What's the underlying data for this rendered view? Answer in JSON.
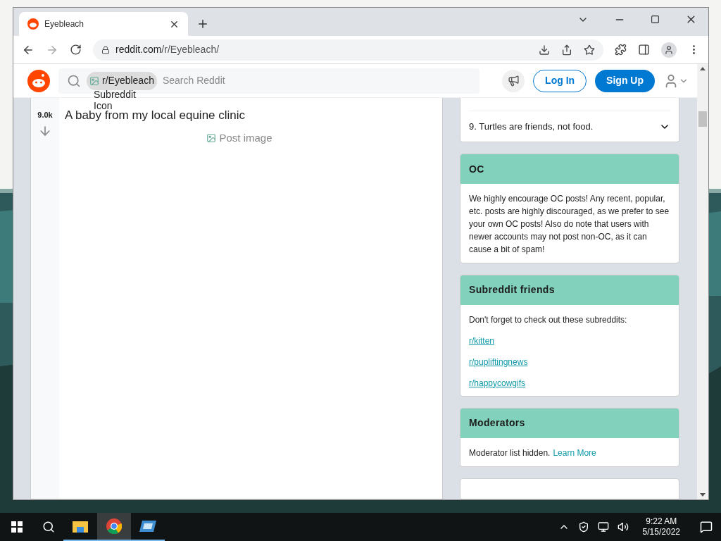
{
  "browser": {
    "tab": {
      "title": "Eyebleach",
      "selected": true
    },
    "url_domain": "reddit.com",
    "url_path": "/r/Eyebleach/"
  },
  "header": {
    "community_chip": "r/Eyebleach",
    "chip_icon_alt": "Subreddit Icon",
    "search_placeholder": "Search Reddit",
    "login": "Log In",
    "signup": "Sign Up"
  },
  "post": {
    "score": "9.0k",
    "title": "A baby from my local equine clinic",
    "image_alt": "Post image"
  },
  "rules": [
    {
      "text": "9. Turtles are friends, not food.",
      "expanded": false
    }
  ],
  "widgets": [
    {
      "title": "OC",
      "kind": "text",
      "body": "We highly encourage OC posts! Any recent, popular, etc. posts are highly discouraged, as we prefer to see your own OC posts! Also do note that users with newer accounts may not post non-OC, as it can cause a bit of spam!"
    },
    {
      "title": "Subreddit friends",
      "kind": "links",
      "body": "Don't forget to check out these subreddits:",
      "links": [
        "r/kitten",
        "r/pupliftingnews",
        "r/happycowgifs"
      ]
    },
    {
      "title": "Moderators",
      "kind": "note",
      "body": "Moderator list hidden.",
      "link": "Learn More"
    }
  ],
  "taskbar": {
    "time": "9:22 AM",
    "date": "5/15/2022",
    "apps": [
      {
        "kind": "explorer",
        "selected": false
      },
      {
        "kind": "chrome",
        "selected": true
      },
      {
        "kind": "app",
        "selected": false
      }
    ]
  }
}
